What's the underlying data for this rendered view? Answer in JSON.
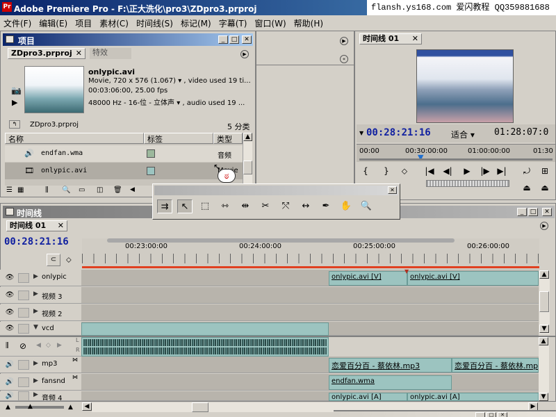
{
  "window": {
    "title": "Adobe Premiere Pro - F:\\正大洗化\\pro3\\ZDpro3.prproj",
    "watermark": "flansh.ys168.com 爱闪教程 QQ359881688"
  },
  "menu": [
    "文件(F)",
    "编辑(E)",
    "项目",
    "素材(C)",
    "时间线(S)",
    "标记(M)",
    "字幕(T)",
    "窗口(W)",
    "帮助(H)"
  ],
  "project": {
    "panel_title": "项目",
    "tabs": [
      "ZDpro3.prproj",
      "特效"
    ],
    "clip": {
      "name": "onlypic.avi",
      "line1": "Movie, 720 x 576 (1.067)",
      "line1b": ", video used 19 ti...",
      "line2": "00:03:06:00, 25.00 fps",
      "line3": "48000 Hz - 16-位 - 立体声",
      "line3b": ", audio used 19 ..."
    },
    "folder": "ZDpro3.prproj",
    "count": "5 分类",
    "columns": [
      "名称",
      "标签",
      "类型"
    ],
    "rows": [
      {
        "name": "endfan.wma",
        "type": "音频",
        "label_color": "#9cb89c"
      },
      {
        "name": "onlypic.avi",
        "type": "Movie",
        "label_color": "#9cc4c0"
      }
    ]
  },
  "monitor": {
    "tab": "时间线 01",
    "timecode": "00:28:21:16",
    "fit": "适合",
    "duration": "01:28:07:0",
    "ruler": [
      "00:00",
      "00:30:00:00",
      "01:00:00:00",
      "01:30"
    ]
  },
  "tools_panel": {
    "tools": [
      "track-select",
      "selection",
      "ripple-edit",
      "rolling-edit",
      "rate-stretch",
      "razor",
      "slip",
      "slide",
      "pen",
      "hand",
      "zoom"
    ]
  },
  "timeline": {
    "panel_title": "时间线",
    "tab": "时间线 01",
    "timecode": "00:28:21:16",
    "ruler": [
      "00:23:00:00",
      "00:24:00:00",
      "00:25:00:00",
      "00:26:00:00"
    ],
    "tracks": [
      {
        "name": "onlypic"
      },
      {
        "name": "视频 3"
      },
      {
        "name": "视频 2"
      },
      {
        "name": "vcd"
      },
      {
        "name": "mp3"
      },
      {
        "name": "fansnd"
      },
      {
        "name": "音频 4"
      }
    ],
    "clips": {
      "v1a": "onlypic.avi [V]",
      "v1b": "onlypic.avi [V]",
      "mp3a": "恋爱百分百 - 蔡依林.mp3",
      "mp3b": "恋爱百分百 - 蔡依林.mp3",
      "fan": "endfan.wma",
      "a4a": "onlypic.avi [A]",
      "a4b": "onlypic.avi [A]"
    },
    "audio_channels": [
      "L",
      "R"
    ]
  }
}
